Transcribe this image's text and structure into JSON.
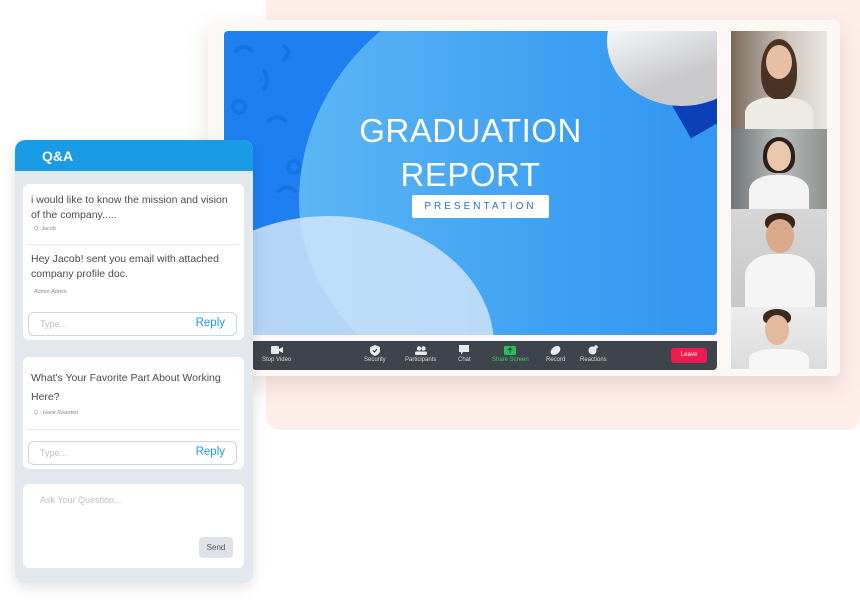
{
  "slide": {
    "title_line1": "GRADUATION",
    "title_line2": "REPORT",
    "subtitle": "PRESENTATION"
  },
  "toolbar": {
    "items": [
      {
        "label": "Stop Video",
        "icon": "video-camera-icon"
      },
      {
        "label": "Security",
        "icon": "shield-check-icon"
      },
      {
        "label": "Participants",
        "icon": "people-icon"
      },
      {
        "label": "Chat",
        "icon": "chat-bubble-icon"
      },
      {
        "label": "Share Screen",
        "icon": "share-screen-icon",
        "color": "#3fd16b"
      },
      {
        "label": "Record",
        "icon": "record-icon"
      },
      {
        "label": "Reactions",
        "icon": "reactions-icon"
      }
    ],
    "leave_label": "Leave",
    "leave_color": "#ee1c4e"
  },
  "participants": [
    {
      "name": "participant-1"
    },
    {
      "name": "participant-2"
    },
    {
      "name": "participant-3"
    },
    {
      "name": "participant-4"
    }
  ],
  "qa": {
    "title": "Q&A",
    "accent": "#1a9be6",
    "threads": [
      {
        "question": "i would like to know the mission and vision of the company.....",
        "asker": "Q: Jacob",
        "answer": "Hey Jacob! sent you email with attached company profile doc.",
        "answerer": "Admin:Admin",
        "reply_placeholder": "Type...",
        "reply_label": "Reply"
      },
      {
        "question": "What's Your Favorite Part About Working Here?",
        "asker": "Q : Hank Rearden",
        "reply_placeholder": "Type...",
        "reply_label": "Reply"
      }
    ],
    "ask_placeholder": "Ask Your Question...",
    "send_label": "Send"
  }
}
